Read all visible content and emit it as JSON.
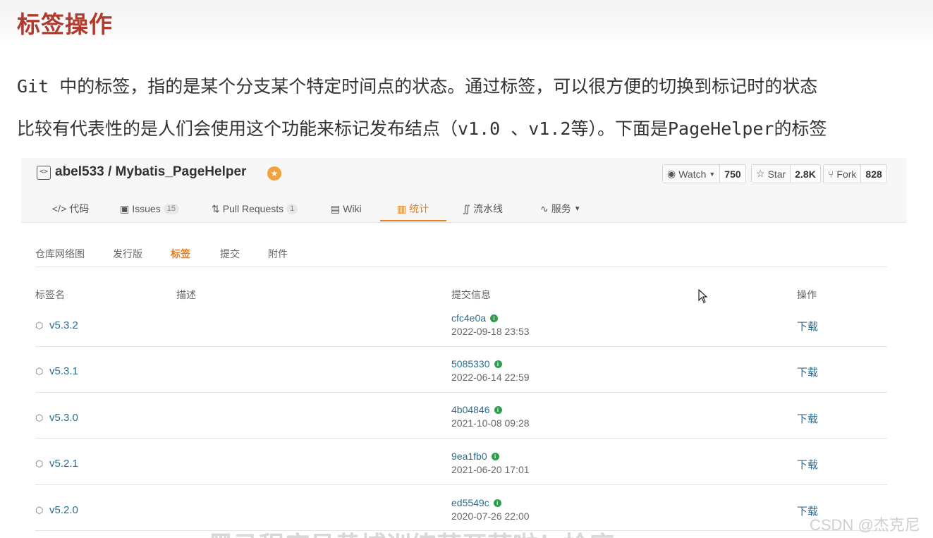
{
  "page": {
    "title": "标签操作",
    "paragraph1": "Git 中的标签，指的是某个分支某个特定时间点的状态。通过标签，可以很方便的切换到标记时的状态",
    "paragraph2": "比较有代表性的是人们会使用这个功能来标记发布结点（v1.0 、v1.2等）。下面是PageHelper的标签"
  },
  "repo": {
    "icon": "code-repo-icon",
    "name": "abel533 / Mybatis_PageHelper",
    "badge_icon": "recommended-badge-icon",
    "watch": {
      "label": "Watch",
      "count": "750"
    },
    "star": {
      "label": "Star",
      "count": "2.8K"
    },
    "fork": {
      "label": "Fork",
      "count": "828"
    }
  },
  "tabs": [
    {
      "label": "代码",
      "icon": "code-icon"
    },
    {
      "label": "Issues",
      "icon": "issues-icon",
      "count": "15"
    },
    {
      "label": "Pull Requests",
      "icon": "pull-request-icon",
      "count": "1"
    },
    {
      "label": "Wiki",
      "icon": "wiki-icon"
    },
    {
      "label": "统计",
      "icon": "chart-icon"
    },
    {
      "label": "流水线",
      "icon": "pipeline-icon"
    },
    {
      "label": "服务",
      "icon": "pulse-icon"
    }
  ],
  "subnav": [
    "仓库网络图",
    "发行版",
    "标签",
    "提交",
    "附件"
  ],
  "table": {
    "headers": {
      "name": "标签名",
      "desc": "描述",
      "commit": "提交信息",
      "action": "操作"
    },
    "rows": [
      {
        "tag": "v5.3.2",
        "hash": "cfc4e0a",
        "date": "2022-09-18 23:53",
        "action": "下载"
      },
      {
        "tag": "v5.3.1",
        "hash": "5085330",
        "date": "2022-06-14 22:59",
        "action": "下载"
      },
      {
        "tag": "v5.3.0",
        "hash": "4b04846",
        "date": "2021-10-08 09:28",
        "action": "下载"
      },
      {
        "tag": "v5.2.1",
        "hash": "9ea1fb0",
        "date": "2021-06-20 17:01",
        "action": "下载"
      },
      {
        "tag": "v5.2.0",
        "hash": "ed5549c",
        "date": "2020-07-26 22:00",
        "action": "下载"
      }
    ]
  },
  "watermark": "CSDN @杰克尼",
  "bottom_subtitle": "黑马程序员黄埔训练营开营啦！抢座 "
}
